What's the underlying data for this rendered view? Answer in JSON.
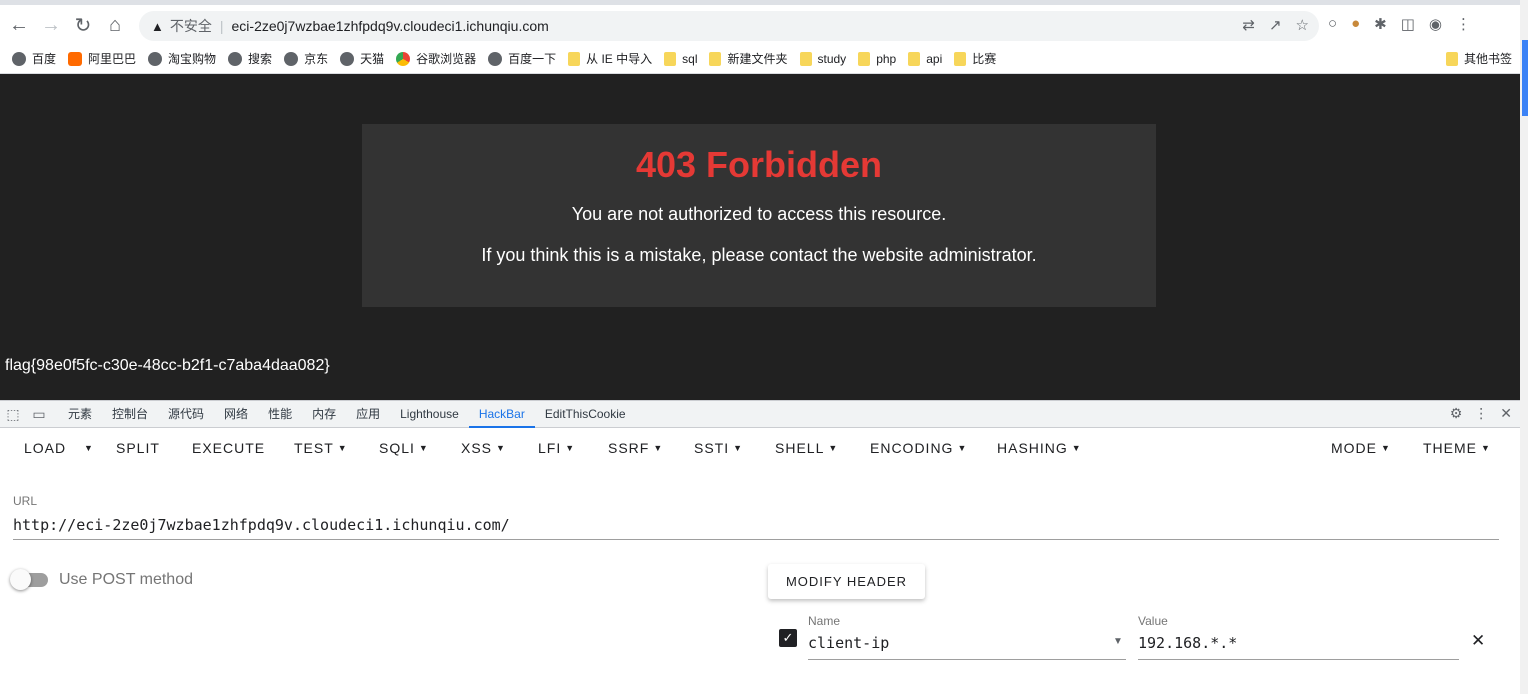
{
  "browser": {
    "security_label": "不安全",
    "url": "eci-2ze0j7wzbae1zhfpdq9v.cloudeci1.ichunqiu.com",
    "bookmarks": [
      "百度",
      "阿里巴巴",
      "淘宝购物",
      "搜索",
      "京东",
      "天猫",
      "谷歌浏览器",
      "百度一下",
      "从 IE 中导入",
      "sql",
      "新建文件夹",
      "study",
      "php",
      "api",
      "比赛"
    ],
    "other_bookmarks": "其他书签"
  },
  "page": {
    "title": "403 Forbidden",
    "line1": "You are not authorized to access this resource.",
    "line2": "If you think this is a mistake, please contact the website administrator.",
    "flag": "flag{98e0f5fc-c30e-48cc-b2f1-c7aba4daa082}"
  },
  "devtools": {
    "tabs": [
      "元素",
      "控制台",
      "源代码",
      "网络",
      "性能",
      "内存",
      "应用",
      "Lighthouse",
      "HackBar",
      "EditThisCookie"
    ],
    "active_tab": "HackBar"
  },
  "hackbar": {
    "menu": {
      "load": "LOAD",
      "split": "SPLIT",
      "execute": "EXECUTE",
      "test": "TEST",
      "sqli": "SQLI",
      "xss": "XSS",
      "lfi": "LFI",
      "ssrf": "SSRF",
      "ssti": "SSTI",
      "shell": "SHELL",
      "encoding": "ENCODING",
      "hashing": "HASHING",
      "mode": "MODE",
      "theme": "THEME"
    },
    "url_label": "URL",
    "url_value": "http://eci-2ze0j7wzbae1zhfpdq9v.cloudeci1.ichunqiu.com/",
    "post_label": "Use POST method",
    "modify_header": "MODIFY HEADER",
    "header": {
      "name_label": "Name",
      "name": "client-ip",
      "value_label": "Value",
      "value": "192.168.*.*",
      "enabled": true
    }
  },
  "colors": {
    "error_title": "#e53935",
    "page_bg": "#212121",
    "box_bg": "#333333",
    "accent": "#1a73e8"
  }
}
